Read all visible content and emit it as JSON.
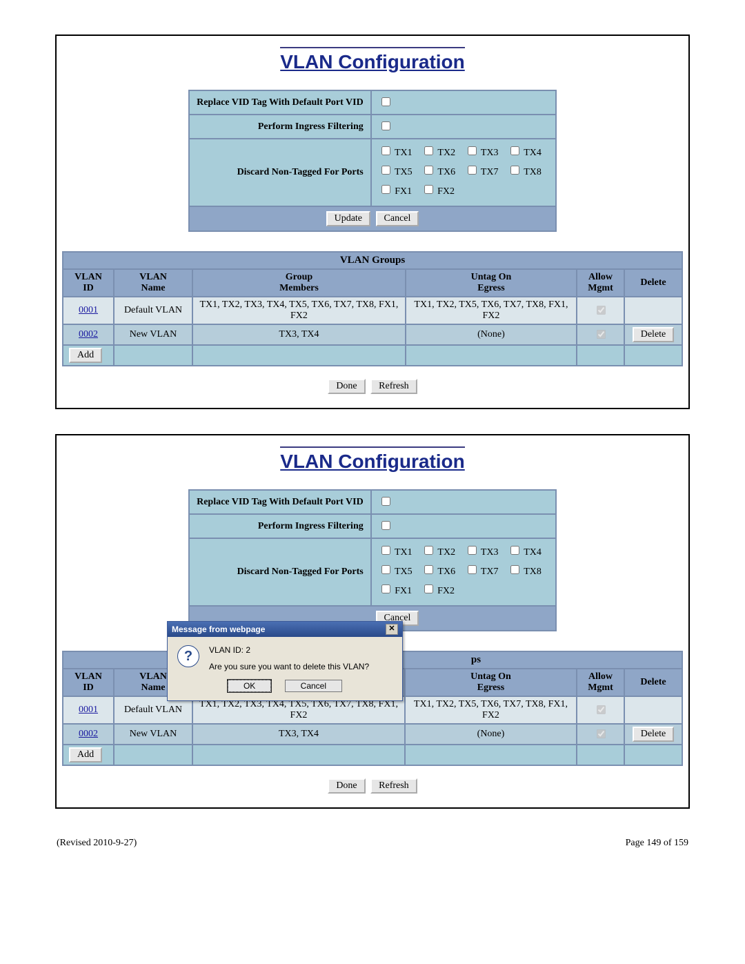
{
  "page_title": "VLAN Configuration",
  "config": {
    "row1_label": "Replace VID Tag With Default Port VID",
    "row2_label": "Perform Ingress Filtering",
    "row3_label": "Discard Non-Tagged For Ports",
    "ports": [
      "TX1",
      "TX2",
      "TX3",
      "TX4",
      "TX5",
      "TX6",
      "TX7",
      "TX8",
      "FX1",
      "FX2"
    ],
    "update_btn": "Update",
    "cancel_btn": "Cancel"
  },
  "groups": {
    "title": "VLAN Groups",
    "headers": {
      "id": "VLAN\nID",
      "name": "VLAN\nName",
      "members": "Group\nMembers",
      "untag": "Untag On\nEgress",
      "mgmt": "Allow\nMgmt",
      "delete": "Delete"
    },
    "rows": [
      {
        "id": "0001",
        "name": "Default VLAN",
        "members": "TX1, TX2, TX3, TX4, TX5, TX6, TX7, TX8, FX1, FX2",
        "untag": "TX1, TX2, TX5, TX6, TX7, TX8, FX1, FX2",
        "mgmt_checked": true,
        "deletable": false
      },
      {
        "id": "0002",
        "name": "New VLAN",
        "members": "TX3, TX4",
        "untag": "(None)",
        "mgmt_checked": true,
        "deletable": true
      }
    ],
    "add_btn": "Add",
    "delete_btn": "Delete"
  },
  "bottom": {
    "done": "Done",
    "refresh": "Refresh"
  },
  "modal": {
    "title": "Message from webpage",
    "line1": "VLAN ID:  2",
    "line2": "Are you sure you want to delete this VLAN?",
    "ok": "OK",
    "cancel": "Cancel"
  },
  "footer": {
    "left": "(Revised 2010-9-27)",
    "right": "Page 149 of 159"
  }
}
